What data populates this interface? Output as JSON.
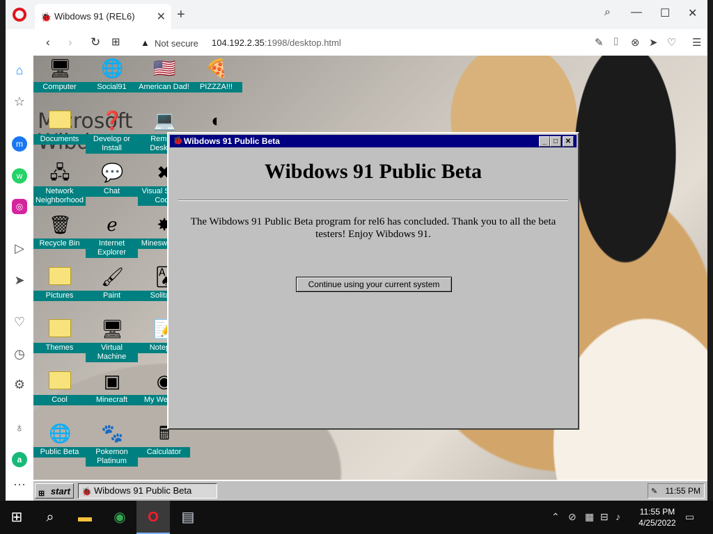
{
  "browser": {
    "tab_title": "Wibdows 91 (REL6)",
    "security_label": "Not secure",
    "url_host": "104.192.2.35",
    "url_path": ":1998/desktop.html"
  },
  "desktop": {
    "watermark_line1": "Microsoft",
    "watermark_line2": "Wibdows",
    "icons": [
      {
        "label": "Computer",
        "glyph": "🖥"
      },
      {
        "label": "Social91",
        "glyph": "🌐"
      },
      {
        "label": "American Dad!",
        "glyph": "🇺🇸"
      },
      {
        "label": "PIZZZA!!!",
        "glyph": "🍕"
      },
      {
        "label": "Documents",
        "glyph": "folder"
      },
      {
        "label": "Develop or Install",
        "glyph": "❓"
      },
      {
        "label": "Remote Desktop",
        "glyph": "💻"
      },
      {
        "label": "",
        "glyph": "◐"
      },
      {
        "label": "Network Neighborhood",
        "glyph": "🖧"
      },
      {
        "label": "Chat",
        "glyph": "💬"
      },
      {
        "label": "Visual Studio Code",
        "glyph": "✖"
      },
      {
        "label": "Recycle Bin",
        "glyph": "🗑"
      },
      {
        "label": "Internet Explorer",
        "glyph": "ℯ"
      },
      {
        "label": "Minesweeper",
        "glyph": "✸"
      },
      {
        "label": "Pictures",
        "glyph": "folder"
      },
      {
        "label": "Paint",
        "glyph": "🖌"
      },
      {
        "label": "Solitaire",
        "glyph": "🂡"
      },
      {
        "label": "Themes",
        "glyph": "folder"
      },
      {
        "label": "Virtual Machine",
        "glyph": "🖥"
      },
      {
        "label": "Notepad",
        "glyph": "📝"
      },
      {
        "label": "Cool",
        "glyph": "folder"
      },
      {
        "label": "Minecraft",
        "glyph": "▣"
      },
      {
        "label": "My Website",
        "glyph": "◉"
      },
      {
        "label": "Public Beta",
        "glyph": "🌐"
      },
      {
        "label": "Pokemon Platinum",
        "glyph": "🐾"
      },
      {
        "label": "Calculator",
        "glyph": "🖩"
      }
    ]
  },
  "dialog": {
    "title": "Wibdows 91 Public Beta",
    "heading": "Wibdows 91 Public Beta",
    "message": "The Wibdows 91 Public Beta program for rel6 has concluded. Thank you to all the beta testers! Enjoy Wibdows 91.",
    "button_label": "Continue using your current system"
  },
  "w95taskbar": {
    "start_label": "start",
    "task_label": "Wibdows 91 Public Beta",
    "time": "11:55 PM"
  },
  "win10": {
    "time": "11:55 PM",
    "date": "4/25/2022"
  }
}
